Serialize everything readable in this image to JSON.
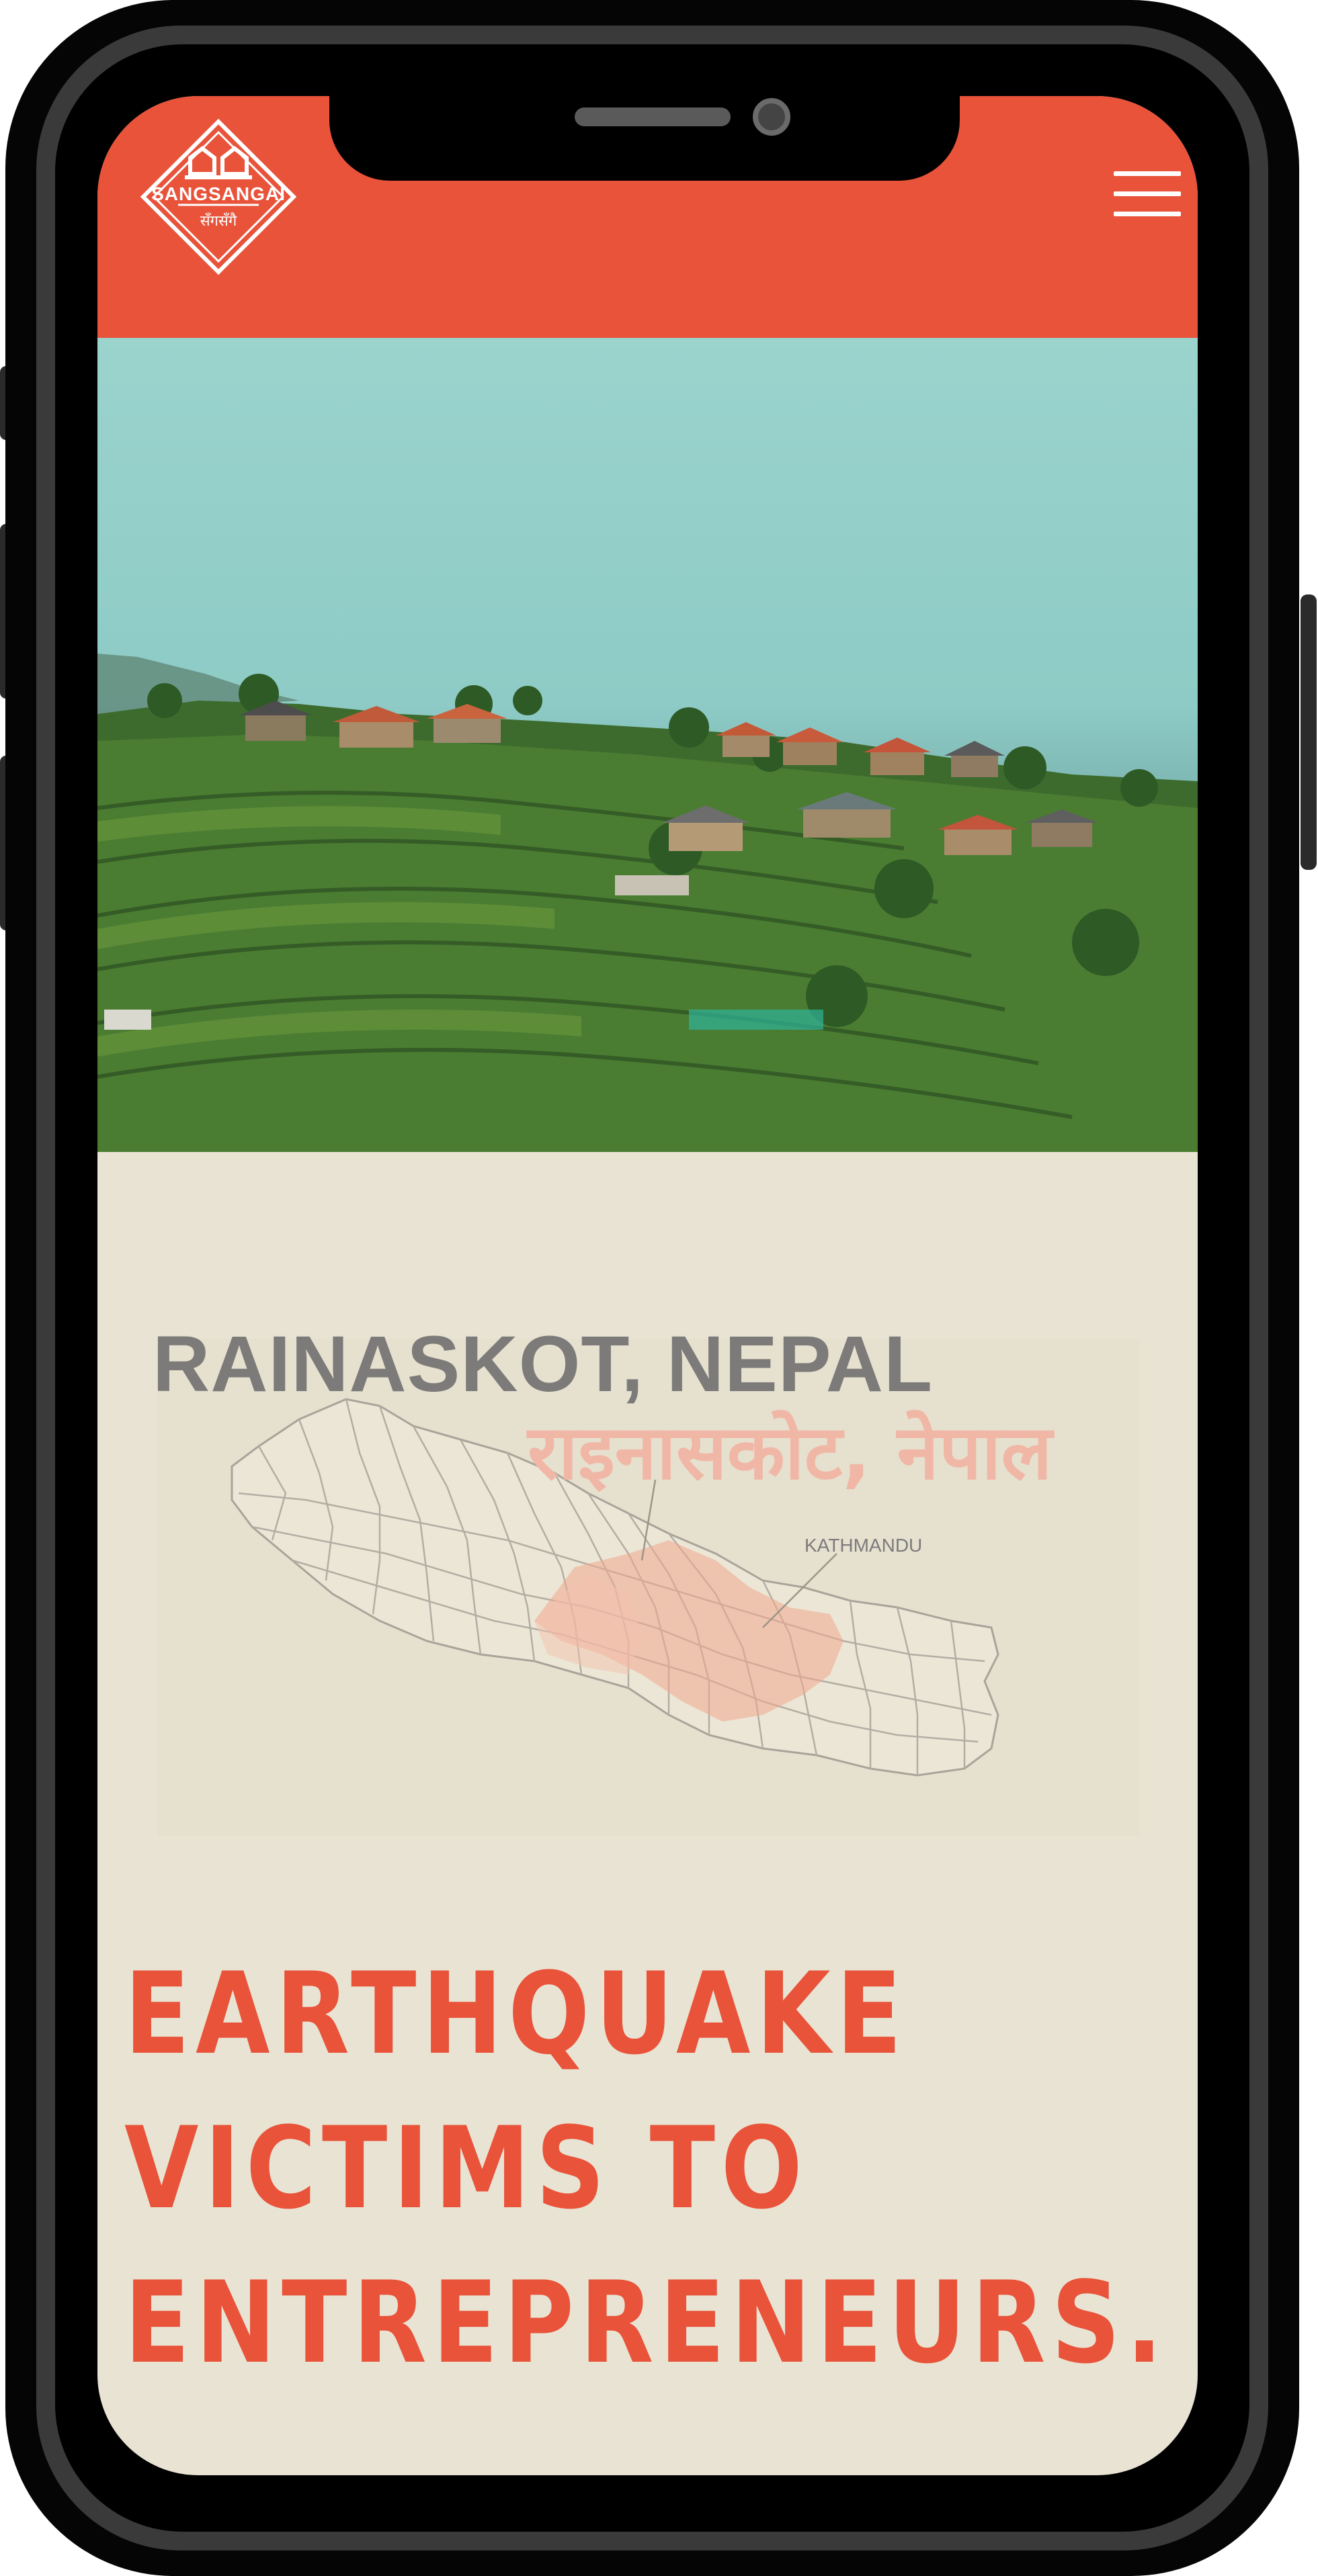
{
  "site": {
    "logo_text": "SANGSANGAI",
    "logo_subtext": "सँगसँगै"
  },
  "header": {
    "menu_icon": "hamburger-menu-icon",
    "background_color": "#e8533a"
  },
  "location": {
    "name_en": "RAINASKOT, NEPAL",
    "name_ne": "राइनासकोट, नेपाल",
    "map_label": "KATHMANDU"
  },
  "headline": {
    "line1": "EARTHQUAKE",
    "line2": "VICTIMS TO",
    "line3": "ENTREPRENEURS."
  },
  "colors": {
    "accent": "#e8533a",
    "background": "#e9e3d3",
    "place_text": "#7d7b79",
    "place_text_ne": "#f1b7a6"
  }
}
